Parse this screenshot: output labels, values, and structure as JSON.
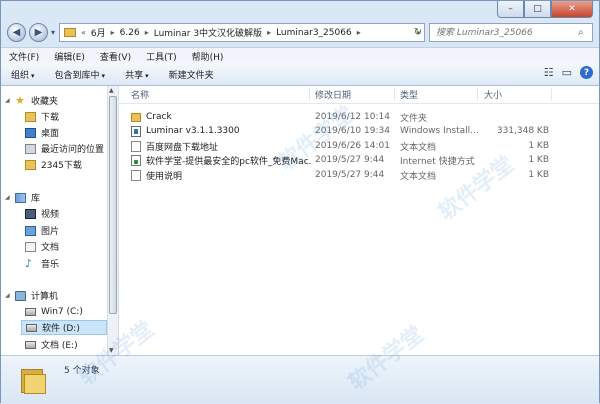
{
  "window": {
    "caption_buttons": {
      "minimize": "–",
      "maximize": "□",
      "close": "✕"
    }
  },
  "navigation": {
    "back_glyph": "◀",
    "forward_glyph": "▶",
    "dropdown_glyph": "▾",
    "refresh_glyph": "↻"
  },
  "address_bar": {
    "prefix": "«",
    "crumbs": [
      "6月",
      "6.26",
      "Luminar 3中文汉化破解版",
      "Luminar3_25066"
    ],
    "separator": "▸"
  },
  "search": {
    "placeholder": "搜索 Luminar3_25066",
    "icon": "search-icon"
  },
  "menu": [
    "文件(F)",
    "编辑(E)",
    "查看(V)",
    "工具(T)",
    "帮助(H)"
  ],
  "toolbar": {
    "items": [
      "组织",
      "包含到库中",
      "共享",
      "新建文件夹"
    ],
    "arrow": "▾"
  },
  "nav_pane": {
    "favorites_label": "收藏夹",
    "favorites": [
      "下载",
      "桌面",
      "最近访问的位置",
      "2345下载"
    ],
    "library_label": "库",
    "library": [
      "视频",
      "图片",
      "文档",
      "音乐"
    ],
    "computer_label": "计算机",
    "drives": [
      "Win7 (C:)",
      "软件 (D:)",
      "文档 (E:)"
    ]
  },
  "columns": {
    "name": "名称",
    "date": "修改日期",
    "type": "类型",
    "size": "大小"
  },
  "files": [
    {
      "name": "Crack",
      "date": "2019/6/12 10:14",
      "type": "文件夹",
      "size": "",
      "icon": "folder"
    },
    {
      "name": "Luminar v3.1.1.3300",
      "date": "2019/6/10 19:34",
      "type": "Windows Install...",
      "size": "331,348 KB",
      "icon": "exe"
    },
    {
      "name": "百度网盘下载地址",
      "date": "2019/6/26 14:01",
      "type": "文本文档",
      "size": "1 KB",
      "icon": "txt"
    },
    {
      "name": "软件学堂-提供最安全的pc软件_免费Mac...",
      "date": "2019/5/27 9:44",
      "type": "Internet 快捷方式",
      "size": "1 KB",
      "icon": "url"
    },
    {
      "name": "使用说明",
      "date": "2019/5/27 9:44",
      "type": "文本文档",
      "size": "1 KB",
      "icon": "txt"
    }
  ],
  "status": {
    "count": "5 个对象"
  },
  "watermark": "软件学堂"
}
